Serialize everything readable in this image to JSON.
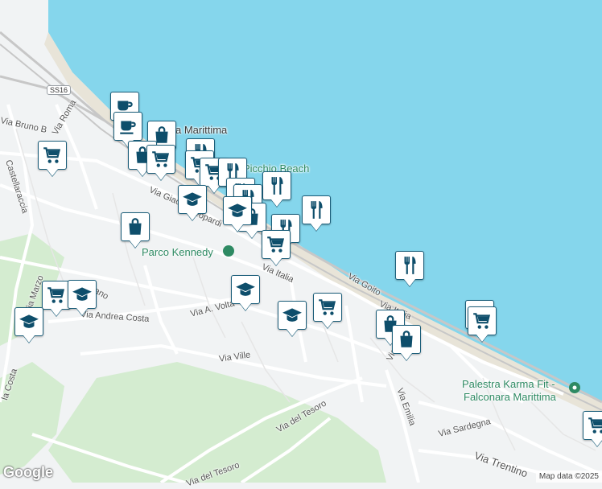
{
  "map": {
    "colors": {
      "sea": "#85d6ec",
      "land": "#f1f3f4",
      "park": "#d4ecd0",
      "road": "#ffffff",
      "rail": "#c7c7c7",
      "pin_icon": "#0e4e6b"
    },
    "labels": {
      "ss16": "SS16",
      "marittima": "a Marittima",
      "picchio_beach": "Picchio Beach",
      "parco_kennedy": "Parco Kennedy",
      "palestra_line1": "Palestra Karma Fit -",
      "palestra_line2": "Falconara Marittima",
      "via_bruno": "Via Bruno B",
      "via_roma": "Via Roma",
      "castellaraccia": "Castellaraccia",
      "via_giacomo": "Via Giac",
      "leopardi": "eopardi",
      "via_italia": "Via Italia",
      "via_goito": "Via Goito",
      "via_italia2": "Via Italia",
      "via_marzo": "Via Marzo",
      "milano": "ilano",
      "via_andrea_costa": "Via Andrea Costa",
      "via_a_volta": "Via A. Volta",
      "via_ville": "Via Ville",
      "la_costa": "la Costa",
      "via_puglie": "Via Puglie",
      "via_emilia": "Via Emilia",
      "via_sardegna": "Via Sardegna",
      "via_trentino": "Via Trentino",
      "via_del_tesoro": "Via del Tesoro",
      "via_del_tesoro2": "Via del Tesoro"
    },
    "pins": [
      {
        "icon": "coffee"
      },
      {
        "icon": "coffee"
      },
      {
        "icon": "shopping-bag"
      },
      {
        "icon": "shopping-bag"
      },
      {
        "icon": "cart"
      },
      {
        "icon": "restaurant"
      },
      {
        "icon": "cart"
      },
      {
        "icon": "cart"
      },
      {
        "icon": "restaurant"
      },
      {
        "icon": "restaurant"
      },
      {
        "icon": "school"
      },
      {
        "icon": "restaurant"
      },
      {
        "icon": "restaurant"
      },
      {
        "icon": "shopping-bag"
      },
      {
        "icon": "restaurant"
      },
      {
        "icon": "cart"
      },
      {
        "icon": "shopping-bag"
      },
      {
        "icon": "cart"
      },
      {
        "icon": "restaurant"
      },
      {
        "icon": "school"
      },
      {
        "icon": "cart"
      },
      {
        "icon": "school"
      },
      {
        "icon": "school"
      },
      {
        "icon": "school"
      },
      {
        "icon": "restaurant"
      },
      {
        "icon": "cart"
      },
      {
        "icon": "shopping-bag"
      },
      {
        "icon": "shopping-bag"
      },
      {
        "icon": "cart"
      },
      {
        "icon": "school"
      },
      {
        "icon": "cart"
      },
      {
        "icon": "cart"
      }
    ],
    "footer": {
      "logo": "Google",
      "attribution": "Map data ©2025"
    }
  }
}
